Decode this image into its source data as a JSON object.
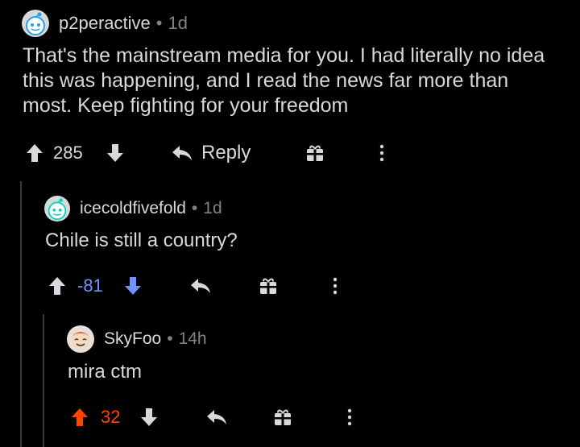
{
  "comments": [
    {
      "username": "p2peractive",
      "separator": "•",
      "age": "1d",
      "body": "That's the mainstream media for you. I had literally no idea this was happening, and I read the news far more than most. Keep fighting for your freedom",
      "score": "285",
      "vote_state": "none",
      "reply_label": "Reply",
      "avatar_icon": "snoo-avatar-icon"
    },
    {
      "username": "icecoldfivefold",
      "separator": "•",
      "age": "1d",
      "body": "Chile is still a country?",
      "score": "-81",
      "vote_state": "downvoted",
      "avatar_icon": "snoo-avatar-icon"
    },
    {
      "username": "SkyFoo",
      "separator": "•",
      "age": "14h",
      "body": "mira ctm",
      "score": "32",
      "vote_state": "upvoted",
      "avatar_icon": "custom-avatar-icon"
    }
  ],
  "colors": {
    "background": "#000000",
    "text": "#d7dadc",
    "muted": "#818384",
    "upvote": "#ff4500",
    "downvote": "#7193ff",
    "thread_line": "#3a3a3c"
  }
}
